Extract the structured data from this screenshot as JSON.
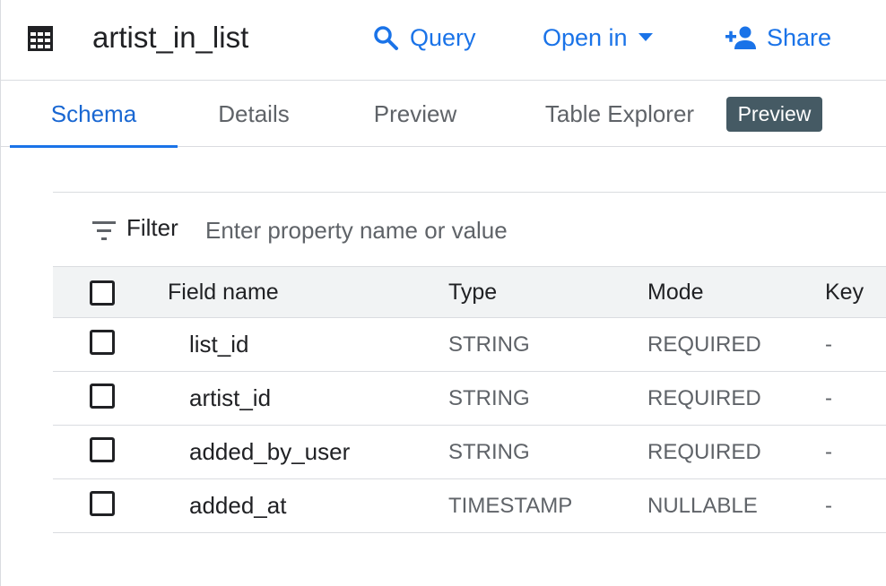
{
  "header": {
    "title": "artist_in_list",
    "actions": {
      "query": "Query",
      "open_in": "Open in",
      "share": "Share"
    }
  },
  "tabs": [
    {
      "label": "Schema",
      "active": true
    },
    {
      "label": "Details",
      "active": false
    },
    {
      "label": "Preview",
      "active": false
    },
    {
      "label": "Table Explorer",
      "active": false
    }
  ],
  "badge": "Preview",
  "filter": {
    "label": "Filter",
    "placeholder": "Enter property name or value",
    "value": ""
  },
  "table": {
    "columns": [
      "Field name",
      "Type",
      "Mode",
      "Key"
    ],
    "rows": [
      {
        "name": "list_id",
        "type": "STRING",
        "mode": "REQUIRED",
        "key": "-"
      },
      {
        "name": "artist_id",
        "type": "STRING",
        "mode": "REQUIRED",
        "key": "-"
      },
      {
        "name": "added_by_user",
        "type": "STRING",
        "mode": "REQUIRED",
        "key": "-"
      },
      {
        "name": "added_at",
        "type": "TIMESTAMP",
        "mode": "NULLABLE",
        "key": "-"
      }
    ]
  },
  "icons": {
    "table": "table-grid-icon",
    "query": "search-icon",
    "open_in": "caret-down-icon",
    "share": "person-add-icon",
    "filter": "filter-lines-icon"
  },
  "colors": {
    "accent": "#1a73e8",
    "badge_bg": "#455a64",
    "header_row_bg": "#f1f3f4",
    "divider": "#dadce0"
  }
}
